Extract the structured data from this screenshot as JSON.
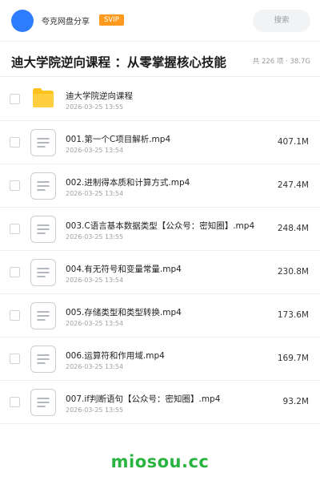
{
  "header": {
    "brand": "夸克网盘分享",
    "badge": "SVIP",
    "search_placeholder": "搜索"
  },
  "title": "迪大学院逆向课程 ：从零掌握核心技能",
  "meta": "共 226 项 · 38.7G",
  "items": [
    {
      "type": "folder",
      "name": "迪大学院逆向课程",
      "date": "2026-03-25 13:55",
      "size": ""
    },
    {
      "type": "file",
      "name": "001.第一个C项目解析.mp4",
      "date": "2026-03-25 13:54",
      "size": "407.1M"
    },
    {
      "type": "file",
      "name": "002.进制得本质和计算方式.mp4",
      "date": "2026-03-25 13:54",
      "size": "247.4M"
    },
    {
      "type": "file",
      "name": "003.C语言基本数据类型【公众号：密知圈】.mp4",
      "date": "2026-03-25 13:55",
      "size": "248.4M"
    },
    {
      "type": "file",
      "name": "004.有无符号和变量常量.mp4",
      "date": "2026-03-25 13:54",
      "size": "230.8M"
    },
    {
      "type": "file",
      "name": "005.存储类型和类型转换.mp4",
      "date": "2026-03-25 13:54",
      "size": "173.6M"
    },
    {
      "type": "file",
      "name": "006.运算符和作用域.mp4",
      "date": "2026-03-25 13:54",
      "size": "169.7M"
    },
    {
      "type": "file",
      "name": "007.if判断语句【公众号：密知圈】.mp4",
      "date": "2026-03-25 13:55",
      "size": "93.2M"
    }
  ],
  "watermark": "miosou.cc",
  "colors": {
    "avatar": "#2f7dff",
    "badge": "#ff9a1f",
    "folder": "#ffc21c",
    "watermark": "#29b33f"
  }
}
